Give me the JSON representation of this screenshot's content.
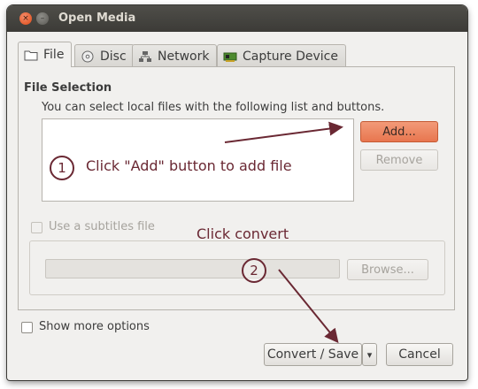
{
  "window": {
    "title": "Open Media",
    "close_glyph": "×",
    "minimize_glyph": "–"
  },
  "tabs": [
    {
      "label": "File",
      "icon": "folder-icon",
      "active": true
    },
    {
      "label": "Disc",
      "icon": "disc-icon",
      "active": false
    },
    {
      "label": "Network",
      "icon": "network-icon",
      "active": false
    },
    {
      "label": "Capture Device",
      "icon": "capture-card-icon",
      "active": false
    }
  ],
  "file_selection": {
    "heading": "File Selection",
    "description": "You can select local files with the following list and buttons.",
    "add_label": "Add...",
    "remove_label": "Remove"
  },
  "subtitles": {
    "checkbox_label": "Use a subtitles file",
    "path_value": "",
    "browse_label": "Browse..."
  },
  "options": {
    "show_more_label": "Show more options"
  },
  "footer": {
    "convert_label": "Convert / Save",
    "dropdown_glyph": "▾",
    "cancel_label": "Cancel"
  },
  "annotations": {
    "step1_number": "1",
    "step1_text": "Click \"Add\" button to add file",
    "step2_number": "2",
    "step2_text": "Click convert"
  },
  "colors": {
    "accent_add_button": "#e8764f",
    "annotation": "#6a2833",
    "titlebar": "#3c3b37"
  }
}
